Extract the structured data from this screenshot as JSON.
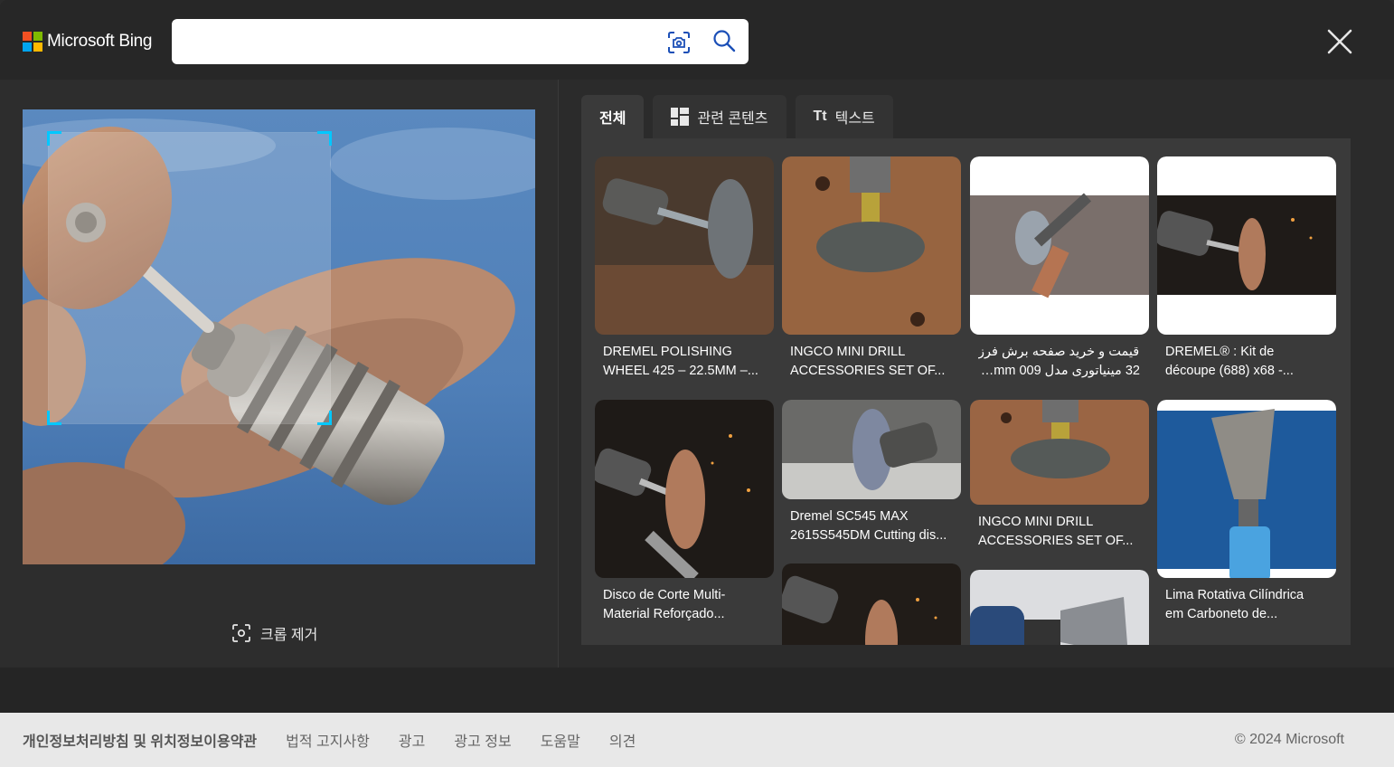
{
  "header": {
    "logo_text": "Microsoft Bing",
    "search_value": "",
    "search_placeholder": "",
    "colors": {
      "ms_red": "#f25022",
      "ms_green": "#7fba00",
      "ms_blue": "#00a4ef",
      "ms_yellow": "#ffb900",
      "icon_blue": "#1b4fb7"
    }
  },
  "left_panel": {
    "remove_crop_label": "크롭 제거",
    "crop_color": "#00c8ff"
  },
  "tabs": [
    {
      "label": "전체",
      "icon": "",
      "active": true
    },
    {
      "label": "관련 콘텐츠",
      "icon": "grid-icon",
      "active": false
    },
    {
      "label": "텍스트",
      "icon": "text-icon",
      "active": false
    }
  ],
  "tab_text_icon_glyph": "Tt",
  "results": {
    "columns": [
      [
        {
          "line1": "DREMEL POLISHING",
          "line2": "WHEEL 425 – 22.5MM –..."
        },
        {
          "line1": "Disco de Corte Multi-",
          "line2": "Material Reforçado..."
        }
      ],
      [
        {
          "line1": "INGCO MINI DRILL",
          "line2": "ACCESSORIES SET OF..."
        },
        {
          "line1": "Dremel SC545 MAX",
          "line2": "2615S545DM Cutting dis..."
        },
        {
          "line1": "",
          "line2": ""
        }
      ],
      [
        {
          "line1": "قیمت و خرید صفحه برش فرز",
          "line2": "32 مینیاتوری مدل mm 009کد..."
        },
        {
          "line1": "INGCO MINI DRILL",
          "line2": "ACCESSORIES SET OF..."
        },
        {
          "line1": "",
          "line2": ""
        }
      ],
      [
        {
          "line1": "DREMEL® : Kit de",
          "line2": "découpe (688) x68 -..."
        },
        {
          "line1": "Lima Rotativa Cilíndrica",
          "line2": "em Carboneto de..."
        }
      ]
    ]
  },
  "footer": {
    "links": [
      "개인정보처리방침 및 위치정보이용약관",
      "법적 고지사항",
      "광고",
      "광고 정보",
      "도움말",
      "의견"
    ],
    "copyright": "© 2024 Microsoft"
  }
}
